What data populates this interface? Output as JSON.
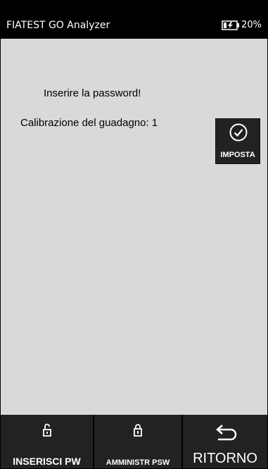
{
  "header": {
    "app_title": "FIATEST GO Analyzer",
    "battery": {
      "percent_label": "20%",
      "icon": "battery-charging-icon"
    }
  },
  "main": {
    "prompt": "Inserire la password!",
    "gain_label": "Calibrazione del guadagno: 1",
    "set_button": {
      "label": "IMPOSTA",
      "icon": "check-circle-icon"
    }
  },
  "footer": {
    "buttons": [
      {
        "label": "INSERISCI PW",
        "icon": "unlock-icon"
      },
      {
        "label": "AMMINISTR PSW",
        "icon": "lock-icon"
      },
      {
        "label": "RITORNO",
        "icon": "return-arrow-icon"
      }
    ]
  },
  "colors": {
    "header_bg": "#000000",
    "content_bg": "#d9d9d9",
    "button_bg": "#222222",
    "text_light": "#ffffff"
  }
}
